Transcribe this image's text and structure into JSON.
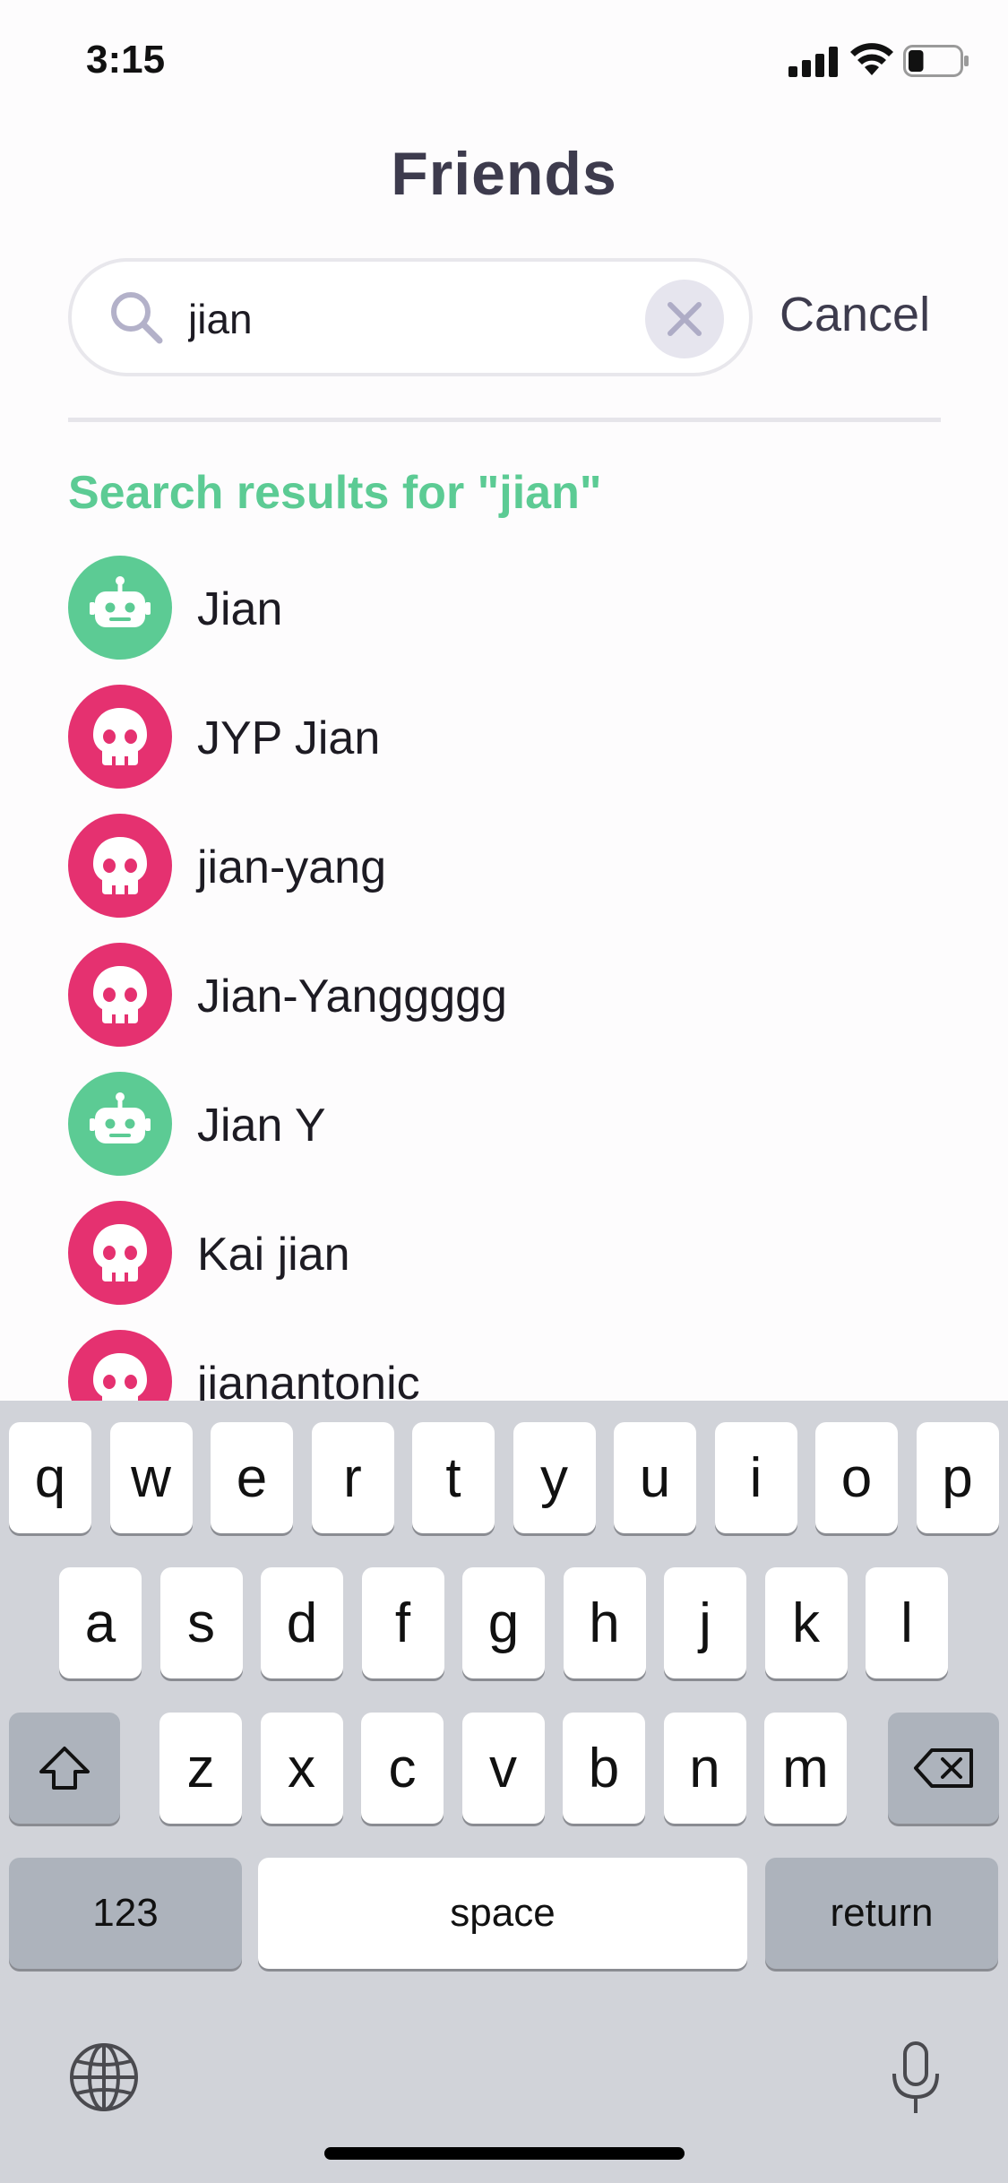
{
  "status_bar": {
    "time": "3:15",
    "battery_level": 0.3
  },
  "header": {
    "title": "Friends"
  },
  "search": {
    "value": "jian",
    "placeholder": "",
    "cancel_label": "Cancel"
  },
  "results": {
    "heading": "Search results for \"jian\"",
    "items": [
      {
        "name": "Jian",
        "avatar": "robot-icon",
        "avatar_color": "#5ccb94"
      },
      {
        "name": "JYP Jian",
        "avatar": "skull-icon",
        "avatar_color": "#e53170"
      },
      {
        "name": "jian-yang",
        "avatar": "skull-icon",
        "avatar_color": "#e53170"
      },
      {
        "name": "Jian-Yanggggg",
        "avatar": "skull-icon",
        "avatar_color": "#e53170"
      },
      {
        "name": "Jian Y",
        "avatar": "robot-icon",
        "avatar_color": "#5ccb94"
      },
      {
        "name": "Kai jian",
        "avatar": "skull-icon",
        "avatar_color": "#e53170"
      },
      {
        "name": "jianantonic",
        "avatar": "skull-icon",
        "avatar_color": "#e53170"
      }
    ]
  },
  "keyboard": {
    "row1": [
      "q",
      "w",
      "e",
      "r",
      "t",
      "y",
      "u",
      "i",
      "o",
      "p"
    ],
    "row2": [
      "a",
      "s",
      "d",
      "f",
      "g",
      "h",
      "j",
      "k",
      "l"
    ],
    "row3": [
      "z",
      "x",
      "c",
      "v",
      "b",
      "n",
      "m"
    ],
    "numbers_label": "123",
    "space_label": "space",
    "return_label": "return"
  },
  "colors": {
    "accent_green": "#5ccb94",
    "accent_pink": "#e53170",
    "title": "#3d3b4d"
  }
}
